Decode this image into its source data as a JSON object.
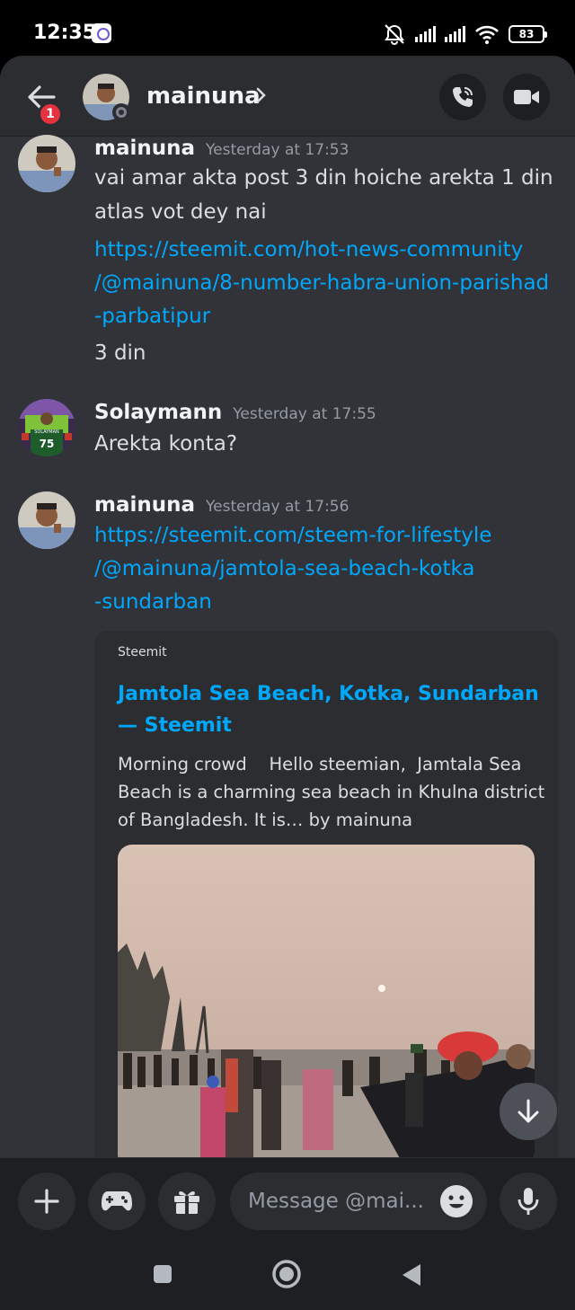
{
  "status_bar": {
    "time": "12:35",
    "battery": "83"
  },
  "header": {
    "title": "mainuna",
    "back_badge": "1"
  },
  "messages": [
    {
      "author": "mainuna",
      "timestamp": "Yesterday at 17:53",
      "lines": [
        "vai amar akta post 3 din hoiche arekta 1 din",
        "atlas vot dey nai"
      ],
      "link_lines": [
        "https://steemit.com/hot-news-community",
        "/@mainuna/8-number-habra-union-parishad",
        "-parbatipur"
      ],
      "after_link": "3 din"
    },
    {
      "author": "Solaymann",
      "timestamp": "Yesterday at 17:55",
      "lines": [
        "Arekta konta?"
      ]
    },
    {
      "author": "mainuna",
      "timestamp": "Yesterday at 17:56",
      "link_lines": [
        "https://steemit.com/steem-for-lifestyle",
        "/@mainuna/jamtola-sea-beach-kotka",
        "-sundarban"
      ]
    }
  ],
  "avatar_badge_text": "SOLAYMAN",
  "avatar_badge_number": "75",
  "embed": {
    "provider": "Steemit",
    "title": "Jamtola Sea Beach, Kotka, Sundarban — Steemit",
    "description": "Morning crowd    Hello steemian,  Jamtala Sea Beach is a charming sea beach in Khulna district of Bangladesh. It is… by mainuna"
  },
  "composer": {
    "placeholder": "Message @mai..."
  },
  "colors": {
    "accent_link": "#00a8fc",
    "background": "#313338",
    "header": "#2b2d31",
    "badge": "#e5323e"
  }
}
